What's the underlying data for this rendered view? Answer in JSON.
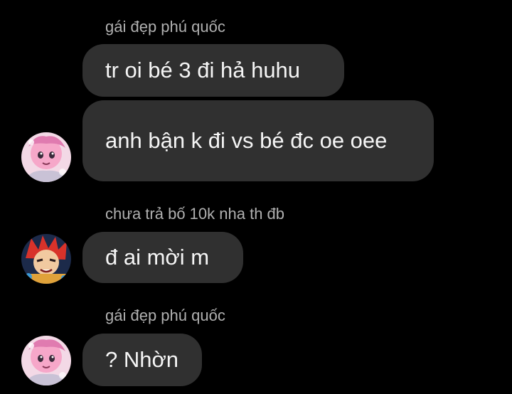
{
  "conversation": {
    "groups": [
      {
        "sender": "gái đẹp phú quốc",
        "avatar": "pink-anime-girl-avatar",
        "messages": [
          "tr oi bé 3 đi hả huhu",
          "anh bận k đi vs bé đc oe oee"
        ]
      },
      {
        "sender": "chưa trả bố 10k nha th đb",
        "avatar": "red-hair-anime-boy-avatar",
        "messages": [
          "đ ai mời m"
        ]
      },
      {
        "sender": "gái đẹp phú quốc",
        "avatar": "pink-anime-girl-avatar",
        "messages": [
          "? Nhờn"
        ]
      }
    ]
  },
  "colors": {
    "background": "#000000",
    "bubble": "#303030",
    "sender_name": "#b0b0b0",
    "message_text": "#f5f5f5"
  }
}
